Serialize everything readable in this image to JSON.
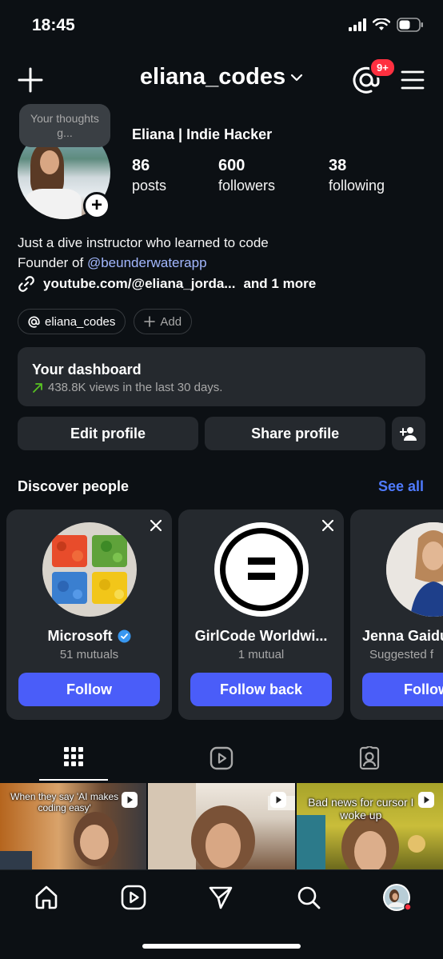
{
  "status_bar": {
    "time": "18:45"
  },
  "header": {
    "username": "eliana_codes",
    "notification_badge": "9+"
  },
  "profile": {
    "note": "Your thoughts g...",
    "display_name": "Eliana | Indie Hacker",
    "stats": [
      {
        "value": "86",
        "label": "posts"
      },
      {
        "value": "600",
        "label": "followers"
      },
      {
        "value": "38",
        "label": "following"
      }
    ],
    "bio_line1": "Just a dive instructor who learned to code",
    "bio_line2_prefix": "Founder of ",
    "bio_mention": "@beunderwaterapp",
    "link_text": "youtube.com/@eliana_jorda...",
    "link_more": "and 1 more",
    "threads_chip": "eliana_codes",
    "add_chip": "Add"
  },
  "dashboard": {
    "title": "Your dashboard",
    "subtitle": "438.8K views in the last 30 days."
  },
  "actions": {
    "edit_profile": "Edit profile",
    "share_profile": "Share profile"
  },
  "discover": {
    "title": "Discover people",
    "see_all": "See all",
    "cards": [
      {
        "name": "Microsoft",
        "subtitle": "51 mutuals",
        "button": "Follow",
        "verified": true
      },
      {
        "name": "GirlCode Worldwi...",
        "subtitle": "1 mutual",
        "button": "Follow back",
        "verified": false
      },
      {
        "name": "Jenna Gaidu",
        "subtitle": "Suggested f",
        "button": "Follow b",
        "verified": false
      }
    ]
  },
  "grid": {
    "captions": [
      "When they say 'AI makes coding easy'",
      "",
      "Bad news for cursor I woke up"
    ]
  },
  "colors": {
    "background": "#0c1014",
    "card": "#25292e",
    "accent_button": "#4a5df9",
    "link_blue": "#4f7bff",
    "badge_red": "#ff3040"
  }
}
